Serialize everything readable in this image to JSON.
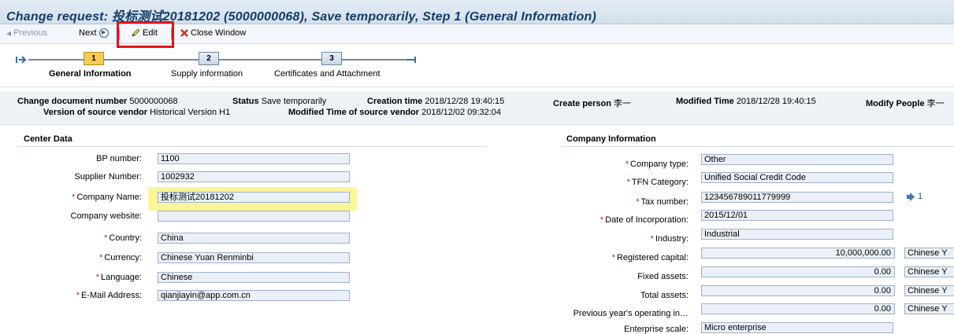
{
  "title": "Change request: 投标测试20181202 (5000000068), Save temporarily, Step 1  (General Information)",
  "toolbar": {
    "previous": "Previous",
    "next": "Next",
    "edit": "Edit",
    "close": "Close Window"
  },
  "roadmap": {
    "steps": [
      {
        "num": "1",
        "label": "General Information",
        "active": true
      },
      {
        "num": "2",
        "label": "Supply information",
        "active": false
      },
      {
        "num": "3",
        "label": "Certificates and Attachment",
        "active": false
      }
    ]
  },
  "header": {
    "change_doc_label": "Change document number",
    "change_doc_value": "5000000068",
    "status_label": "Status",
    "status_value": "Save temporarily",
    "creation_label": "Creation time",
    "creation_value": "2018/12/28 19:40:15",
    "create_person_label": "Create person",
    "create_person_value": "李一",
    "modified_time_label": "Modified Time",
    "modified_time_value": "2018/12/28 19:40:15",
    "modify_people_label": "Modify People",
    "modify_people_value": "李一",
    "version_label": "Version of source vendor",
    "version_value": "Historical Version H1",
    "modified_source_label": "Modified Time of source vendor",
    "modified_source_value": "2018/12/02 09:32:04"
  },
  "center": {
    "title": "Center Data",
    "fields": [
      {
        "label": "BP number:",
        "value": "1100",
        "required": false
      },
      {
        "label": "Supplier Number:",
        "value": "1002932",
        "required": false
      },
      {
        "label": "Company Name:",
        "value": "投标测试20181202",
        "required": true
      },
      {
        "label": "Company website:",
        "value": "",
        "required": false
      },
      {
        "label": "Country:",
        "value": "China",
        "required": true
      },
      {
        "label": "Currency:",
        "value": "Chinese Yuan Renminbi",
        "required": true
      },
      {
        "label": "Language:",
        "value": "Chinese",
        "required": true
      },
      {
        "label": "E-Mail Address:",
        "value": "qianjiayin@app.com.cn",
        "required": true
      }
    ]
  },
  "company": {
    "title": "Company Information",
    "fields": [
      {
        "label": "Company type:",
        "value": "Other",
        "required": true
      },
      {
        "label": "TFN Category:",
        "value": "Unified Social Credit Code",
        "required": true
      },
      {
        "label": "Tax number:",
        "value": "123456789011779999",
        "required": true
      },
      {
        "label": "Date of Incorporation:",
        "value": "2015/12/01",
        "required": true
      },
      {
        "label": "Industry:",
        "value": "Industrial",
        "required": true
      },
      {
        "label": "Registered capital:",
        "value": "10,000,000.00",
        "required": true,
        "currency": "Chinese Y"
      },
      {
        "label": "Fixed assets:",
        "value": "0.00",
        "required": false,
        "currency": "Chinese Y"
      },
      {
        "label": "Total assets:",
        "value": "0.00",
        "required": false,
        "currency": "Chinese Y"
      },
      {
        "label": "Previous year's operating in…",
        "value": "0.00",
        "required": false,
        "currency": "Chinese Y"
      },
      {
        "label": "Enterprise scale:",
        "value": "Micro enterprise",
        "required": false
      }
    ],
    "tax_info_count": "1"
  }
}
